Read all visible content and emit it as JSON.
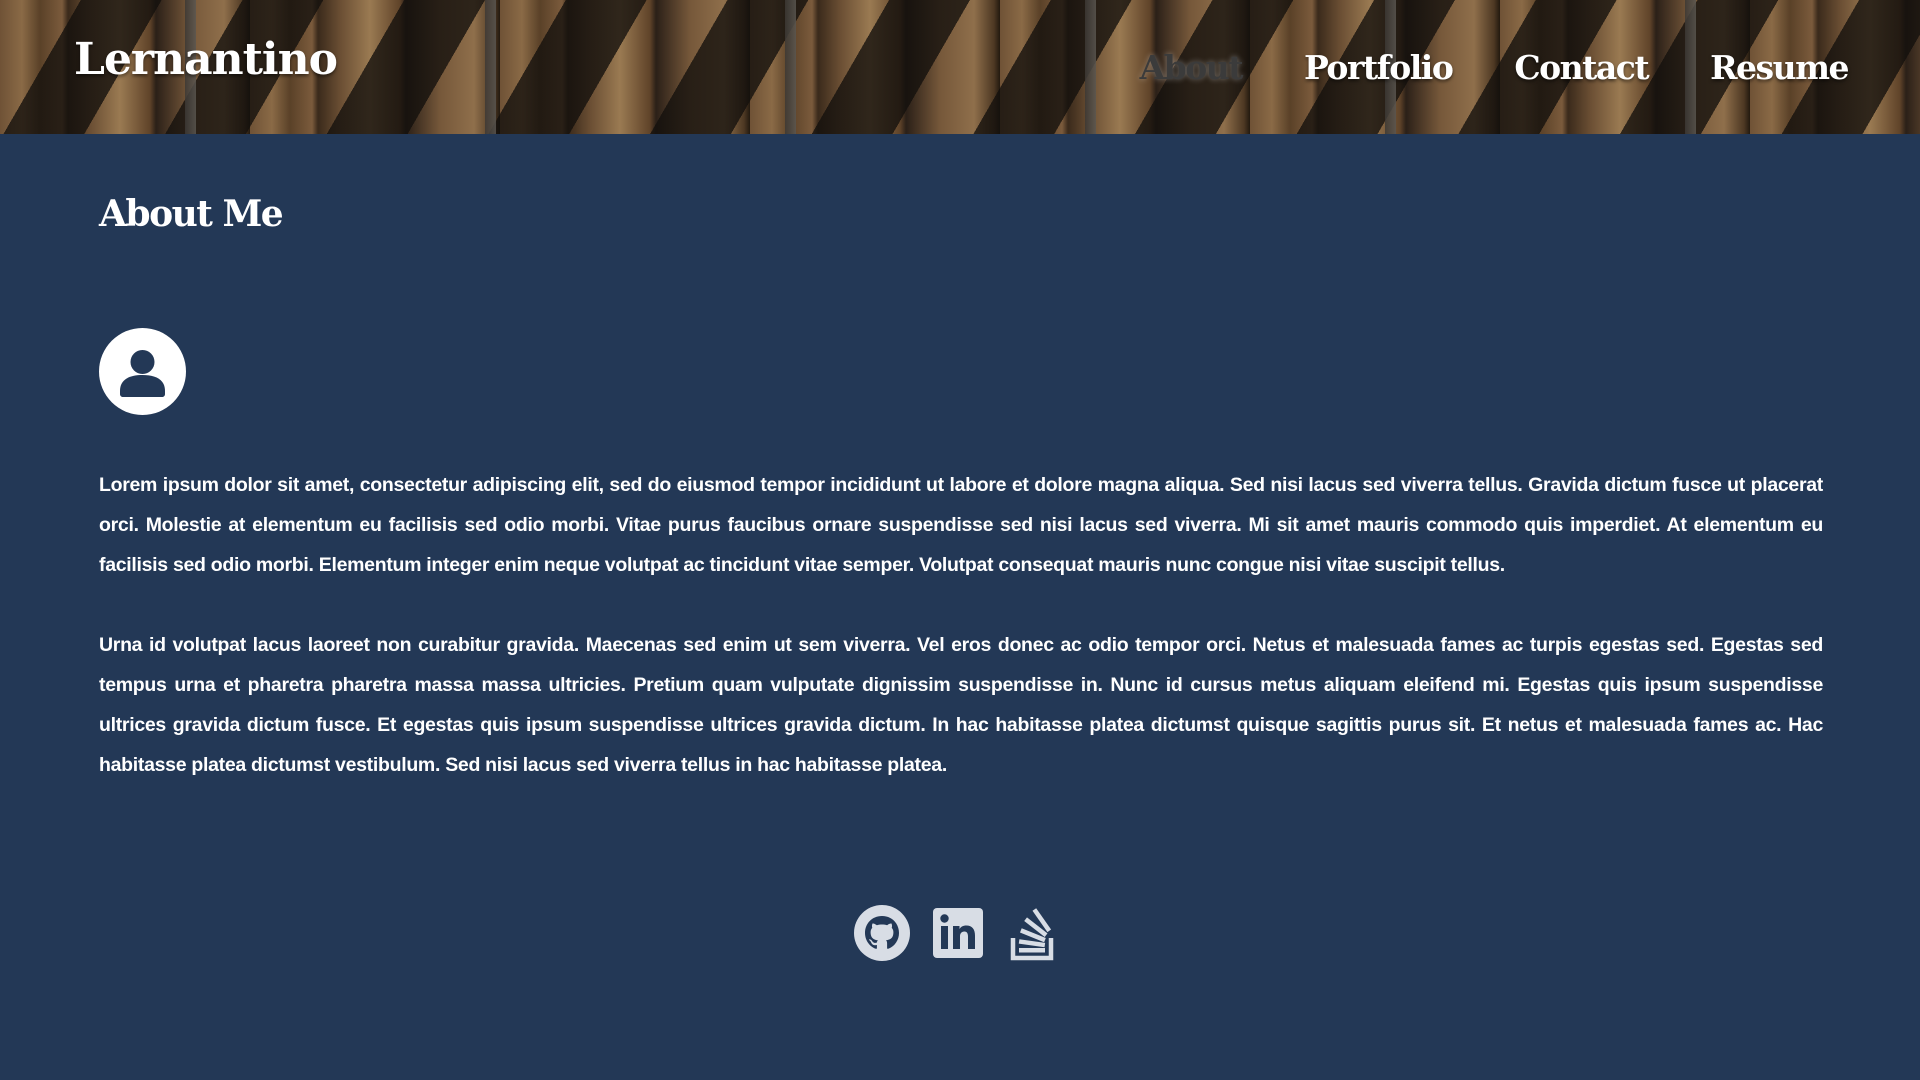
{
  "header": {
    "brand": "Lernantino",
    "nav": [
      {
        "label": "About",
        "active": true
      },
      {
        "label": "Portfolio",
        "active": false
      },
      {
        "label": "Contact",
        "active": false
      },
      {
        "label": "Resume",
        "active": false
      }
    ]
  },
  "main": {
    "title": "About Me",
    "avatar_icon": "user-circle-icon",
    "paragraphs": [
      "Lorem ipsum dolor sit amet, consectetur adipiscing elit, sed do eiusmod tempor incididunt ut labore et dolore magna aliqua. Sed nisi lacus sed viverra tellus. Gravida dictum fusce ut placerat orci. Molestie at elementum eu facilisis sed odio morbi. Vitae purus faucibus ornare suspendisse sed nisi lacus sed viverra. Mi sit amet mauris commodo quis imperdiet. At elementum eu facilisis sed odio morbi. Elementum integer enim neque volutpat ac tincidunt vitae semper. Volutpat consequat mauris nunc congue nisi vitae suscipit tellus.",
      "Urna id volutpat lacus laoreet non curabitur gravida. Maecenas sed enim ut sem viverra. Vel eros donec ac odio tempor orci. Netus et malesuada fames ac turpis egestas sed. Egestas sed tempus urna et pharetra pharetra massa massa ultricies. Pretium quam vulputate dignissim suspendisse in. Nunc id cursus metus aliquam eleifend mi. Egestas quis ipsum suspendisse ultrices gravida dictum fusce. Et egestas quis ipsum suspendisse ultrices gravida dictum. In hac habitasse platea dictumst quisque sagittis purus sit. Et netus et malesuada fames ac. Hac habitasse platea dictumst vestibulum. Sed nisi lacus sed viverra tellus in hac habitasse platea."
    ]
  },
  "footer": {
    "social": [
      {
        "icon": "github-icon"
      },
      {
        "icon": "linkedin-icon"
      },
      {
        "icon": "stack-overflow-icon"
      }
    ]
  },
  "colors": {
    "background": "#233856",
    "text": "#ffffff",
    "nav_active": "#3b3b3b",
    "social_icon": "#d8dde5"
  }
}
